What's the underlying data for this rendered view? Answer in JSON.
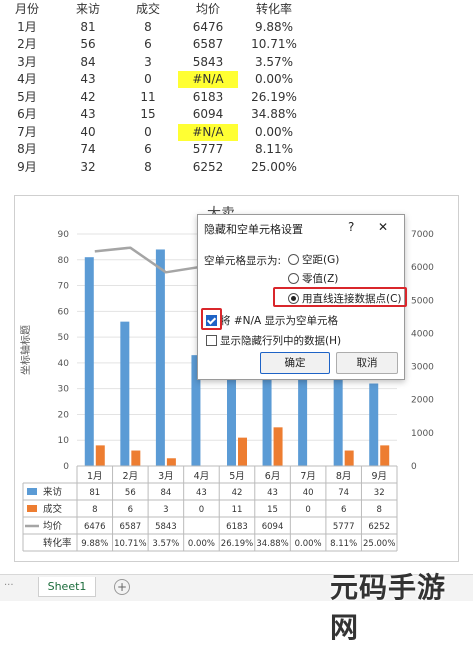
{
  "table": {
    "headers": [
      "月份",
      "来访",
      "成交",
      "均价",
      "转化率"
    ],
    "rows": [
      [
        "1月",
        "81",
        "8",
        "6476",
        "9.88%"
      ],
      [
        "2月",
        "56",
        "6",
        "6587",
        "10.71%"
      ],
      [
        "3月",
        "84",
        "3",
        "5843",
        "3.57%"
      ],
      [
        "4月",
        "43",
        "0",
        "#N/A",
        "0.00%"
      ],
      [
        "5月",
        "42",
        "11",
        "6183",
        "26.19%"
      ],
      [
        "6月",
        "43",
        "15",
        "6094",
        "34.88%"
      ],
      [
        "7月",
        "40",
        "0",
        "#N/A",
        "0.00%"
      ],
      [
        "8月",
        "74",
        "6",
        "5777",
        "8.11%"
      ],
      [
        "9月",
        "32",
        "8",
        "6252",
        "25.00%"
      ]
    ]
  },
  "chart_data": {
    "type": "bar",
    "title": "大卖",
    "ylabel": "坐标轴标题",
    "categories": [
      "1月",
      "2月",
      "3月",
      "4月",
      "5月",
      "6月",
      "7月",
      "8月",
      "9月"
    ],
    "left_axis": {
      "min": 0,
      "max": 90,
      "step": 10,
      "ticks": [
        "0",
        "10",
        "20",
        "30",
        "40",
        "50",
        "60",
        "70",
        "80",
        "90"
      ]
    },
    "right_axis": {
      "min": 0,
      "max": 7000,
      "step": 1000,
      "ticks": [
        "0",
        "1000",
        "2000",
        "3000",
        "4000",
        "5000",
        "6000",
        "7000"
      ]
    },
    "series": [
      {
        "name": "来访",
        "kind": "bar",
        "axis": "left",
        "color": "#5b9bd5",
        "values": [
          81,
          56,
          84,
          43,
          42,
          43,
          40,
          74,
          32
        ]
      },
      {
        "name": "成交",
        "kind": "bar",
        "axis": "left",
        "color": "#ed7d31",
        "values": [
          8,
          6,
          3,
          0,
          11,
          15,
          0,
          6,
          8
        ]
      },
      {
        "name": "均价",
        "kind": "line",
        "axis": "right",
        "color": "#a5a5a5",
        "values": [
          6476,
          6587,
          5843,
          null,
          6183,
          6094,
          null,
          5777,
          6252
        ]
      }
    ],
    "table_rows": [
      {
        "name": "来访",
        "values": [
          "81",
          "56",
          "84",
          "43",
          "42",
          "43",
          "40",
          "74",
          "32"
        ]
      },
      {
        "name": "成交",
        "values": [
          "8",
          "6",
          "3",
          "0",
          "11",
          "15",
          "0",
          "6",
          "8"
        ]
      },
      {
        "name": "均价",
        "values": [
          "6476",
          "6587",
          "5843",
          "",
          "6183",
          "6094",
          "",
          "5777",
          "6252"
        ]
      },
      {
        "name": "转化率",
        "values": [
          "9.88%",
          "10.71%",
          "3.57%",
          "0.00%",
          "26.19%",
          "34.88%",
          "0.00%",
          "8.11%",
          "25.00%"
        ]
      }
    ]
  },
  "dialog": {
    "title": "隐藏和空单元格设置",
    "help_glyph": "?",
    "close_glyph": "✕",
    "section_label": "空单元格显示为:",
    "options": [
      "空距(G)",
      "零值(Z)",
      "用直线连接数据点(C)"
    ],
    "selected_option": 2,
    "na_checkbox_label": "将 #N/A 显示为空单元格",
    "na_checked": true,
    "hidden_checkbox_label": "显示隐藏行列中的数据(H)",
    "hidden_checked": false,
    "ok_label": "确定",
    "cancel_label": "取消"
  },
  "sheet_tab": "Sheet1",
  "add_sheet_glyph": "+",
  "watermark": "元码手游网"
}
